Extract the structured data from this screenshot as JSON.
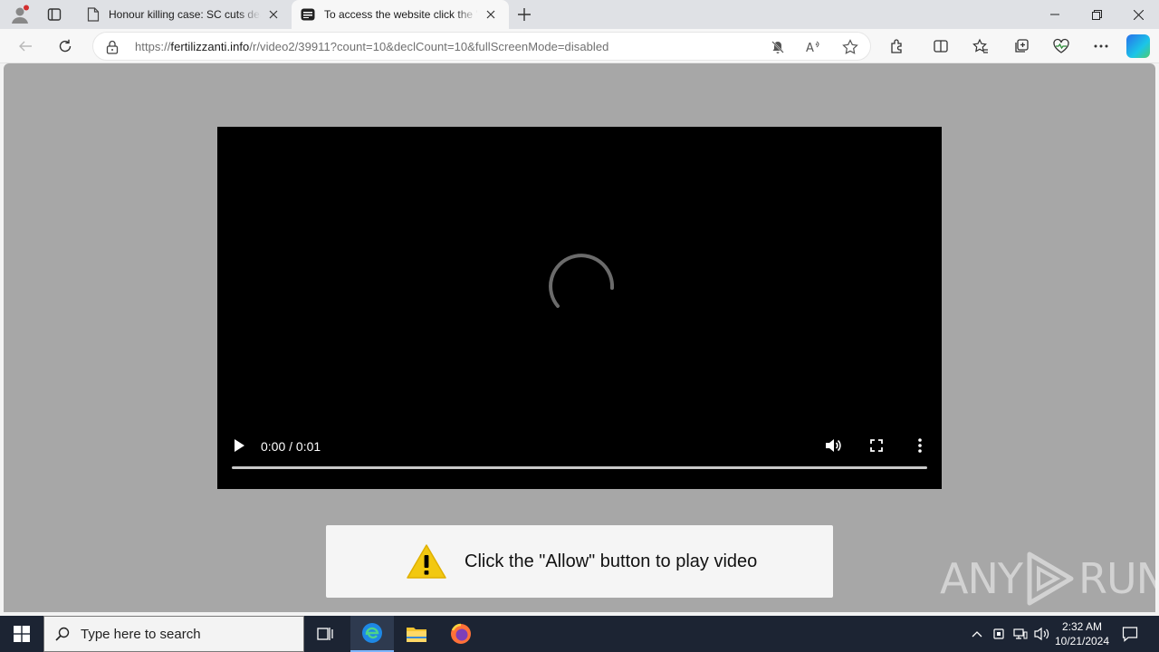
{
  "tabs": [
    {
      "title": "Honour killing case: SC cuts death sentence",
      "icon": "page-icon"
    },
    {
      "title": "To access the website click the \"Allow\" button",
      "icon": "video-site-icon"
    }
  ],
  "address": {
    "prefix": "https://",
    "domain": "fertilizzanti.info",
    "path": "/r/video2/39911?count=10&declCount=10&fullScreenMode=disabled"
  },
  "video": {
    "time": "0:00 / 0:01",
    "progress": 0
  },
  "prompt": {
    "message": "Click the \"Allow\" button to play video"
  },
  "watermark": {
    "left": "ANY",
    "right": "RUN"
  },
  "taskbar": {
    "search_placeholder": "Type here to search",
    "time": "2:32 AM",
    "date": "10/21/2024"
  },
  "colors": {
    "page_bg": "#a7a7a7",
    "taskbar": "#1c2433",
    "warning": "#f2c811"
  }
}
